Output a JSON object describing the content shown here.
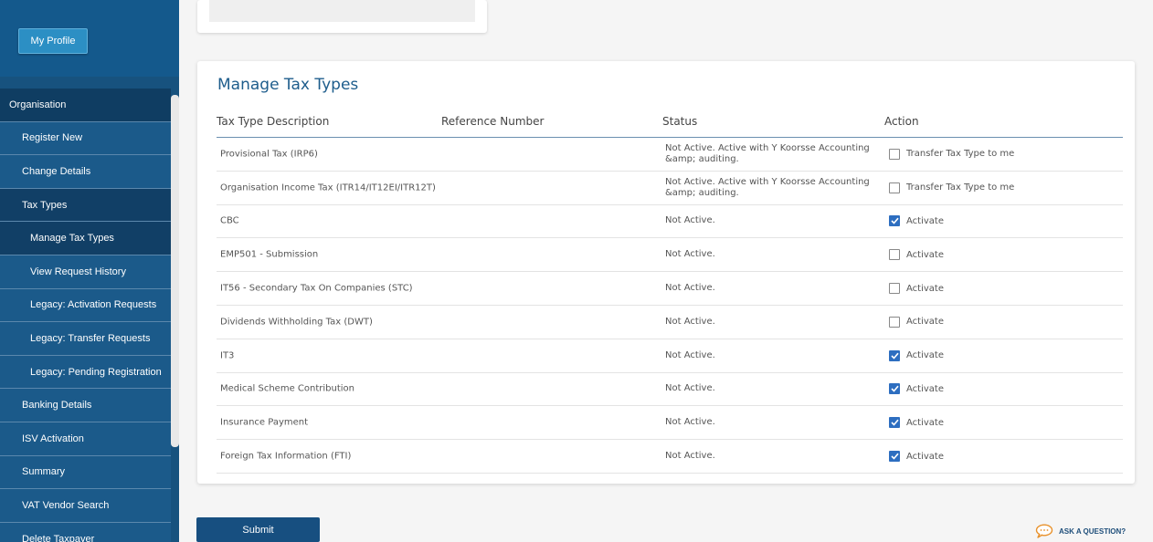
{
  "sidebar": {
    "profile_button": "My Profile",
    "items": [
      {
        "label": "Organisation"
      },
      {
        "label": "Register New"
      },
      {
        "label": "Change Details"
      },
      {
        "label": "Tax Types"
      },
      {
        "label": "Manage Tax Types"
      },
      {
        "label": "View Request History"
      },
      {
        "label": "Legacy: Activation Requests"
      },
      {
        "label": "Legacy: Transfer Requests"
      },
      {
        "label": "Legacy: Pending Registration"
      },
      {
        "label": "Banking Details"
      },
      {
        "label": "ISV Activation"
      },
      {
        "label": "Summary"
      },
      {
        "label": "VAT Vendor Search"
      },
      {
        "label": "Delete Taxpayer"
      }
    ]
  },
  "panel": {
    "title": "Manage Tax Types",
    "columns": {
      "description": "Tax Type Description",
      "reference": "Reference Number",
      "status": "Status",
      "action": "Action"
    },
    "rows": [
      {
        "desc": "Provisional Tax (IRP6)",
        "status": "Not Active. Active with Y Koorsse Accounting &amp; auditing.",
        "action": "Transfer Tax Type to me",
        "checked": false
      },
      {
        "desc": "Organisation Income Tax (ITR14/IT12EI/ITR12T)",
        "status": "Not Active. Active with Y Koorsse Accounting &amp; auditing.",
        "action": "Transfer Tax Type to me",
        "checked": false
      },
      {
        "desc": "CBC",
        "status": "Not Active.",
        "action": "Activate",
        "checked": true
      },
      {
        "desc": "EMP501 - Submission",
        "status": "Not Active.",
        "action": "Activate",
        "checked": false
      },
      {
        "desc": "IT56 - Secondary Tax On Companies (STC)",
        "status": "Not Active.",
        "action": "Activate",
        "checked": false
      },
      {
        "desc": "Dividends Withholding Tax (DWT)",
        "status": "Not Active.",
        "action": "Activate",
        "checked": false
      },
      {
        "desc": "IT3",
        "status": "Not Active.",
        "action": "Activate",
        "checked": true
      },
      {
        "desc": "Medical Scheme Contribution",
        "status": "Not Active.",
        "action": "Activate",
        "checked": true
      },
      {
        "desc": "Insurance Payment",
        "status": "Not Active.",
        "action": "Activate",
        "checked": true
      },
      {
        "desc": "Foreign Tax Information (FTI)",
        "status": "Not Active.",
        "action": "Activate",
        "checked": true
      }
    ]
  },
  "footer": {
    "submit_label": "Submit",
    "ask_label": "ASK A QUESTION?"
  },
  "colors": {
    "sidebar": "#17527e",
    "accent": "#1e5d8c",
    "checkbox_checked": "#2d6ec0"
  }
}
